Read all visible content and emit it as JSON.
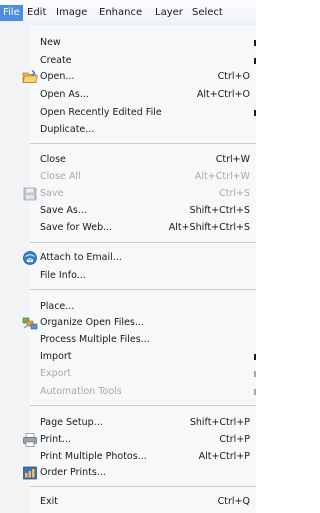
{
  "menubar": {
    "items": [
      {
        "label": "File"
      },
      {
        "label": "Edit"
      },
      {
        "label": "Image"
      },
      {
        "label": "Enhance"
      },
      {
        "label": "Layer"
      },
      {
        "label": "Select"
      }
    ]
  },
  "file_menu": {
    "items": [
      {
        "label": "New",
        "shortcut": "",
        "submenu": true
      },
      {
        "label": "Create",
        "shortcut": "",
        "submenu": true
      },
      {
        "label": "Open...",
        "shortcut": "Ctrl+O",
        "icon": "open-folder-icon"
      },
      {
        "label": "Open As...",
        "shortcut": "Alt+Ctrl+O"
      },
      {
        "label": "Open Recently Edited File",
        "shortcut": "",
        "submenu": true
      },
      {
        "label": "Duplicate...",
        "shortcut": ""
      },
      {
        "label": "Close",
        "shortcut": "Ctrl+W"
      },
      {
        "label": "Close All",
        "shortcut": "Alt+Ctrl+W",
        "disabled": true
      },
      {
        "label": "Save",
        "shortcut": "Ctrl+S",
        "disabled": true,
        "icon": "floppy-disk-icon"
      },
      {
        "label": "Save As...",
        "shortcut": "Shift+Ctrl+S"
      },
      {
        "label": "Save for Web...",
        "shortcut": "Alt+Shift+Ctrl+S"
      },
      {
        "label": "Attach to Email...",
        "shortcut": "",
        "icon": "email-attach-icon"
      },
      {
        "label": "File Info...",
        "shortcut": ""
      },
      {
        "label": "Place...",
        "shortcut": ""
      },
      {
        "label": "Organize Open Files...",
        "shortcut": "",
        "icon": "organize-files-icon"
      },
      {
        "label": "Process Multiple Files...",
        "shortcut": ""
      },
      {
        "label": "Import",
        "shortcut": "",
        "submenu": true
      },
      {
        "label": "Export",
        "shortcut": "",
        "submenu": true,
        "disabled": true
      },
      {
        "label": "Automation Tools",
        "shortcut": "",
        "submenu": true,
        "disabled": true
      },
      {
        "label": "Page Setup...",
        "shortcut": "Shift+Ctrl+P"
      },
      {
        "label": "Print...",
        "shortcut": "Ctrl+P",
        "icon": "printer-icon"
      },
      {
        "label": "Print Multiple Photos...",
        "shortcut": "Alt+Ctrl+P"
      },
      {
        "label": "Order Prints...",
        "shortcut": "",
        "icon": "order-prints-icon"
      },
      {
        "label": "Exit",
        "shortcut": "Ctrl+Q"
      }
    ]
  },
  "colors": {
    "menubar_active": "#4d8ede",
    "menu_background": "#f7f8fa",
    "disabled_text": "#a8a8a8",
    "separator": "#c9ccd1"
  }
}
